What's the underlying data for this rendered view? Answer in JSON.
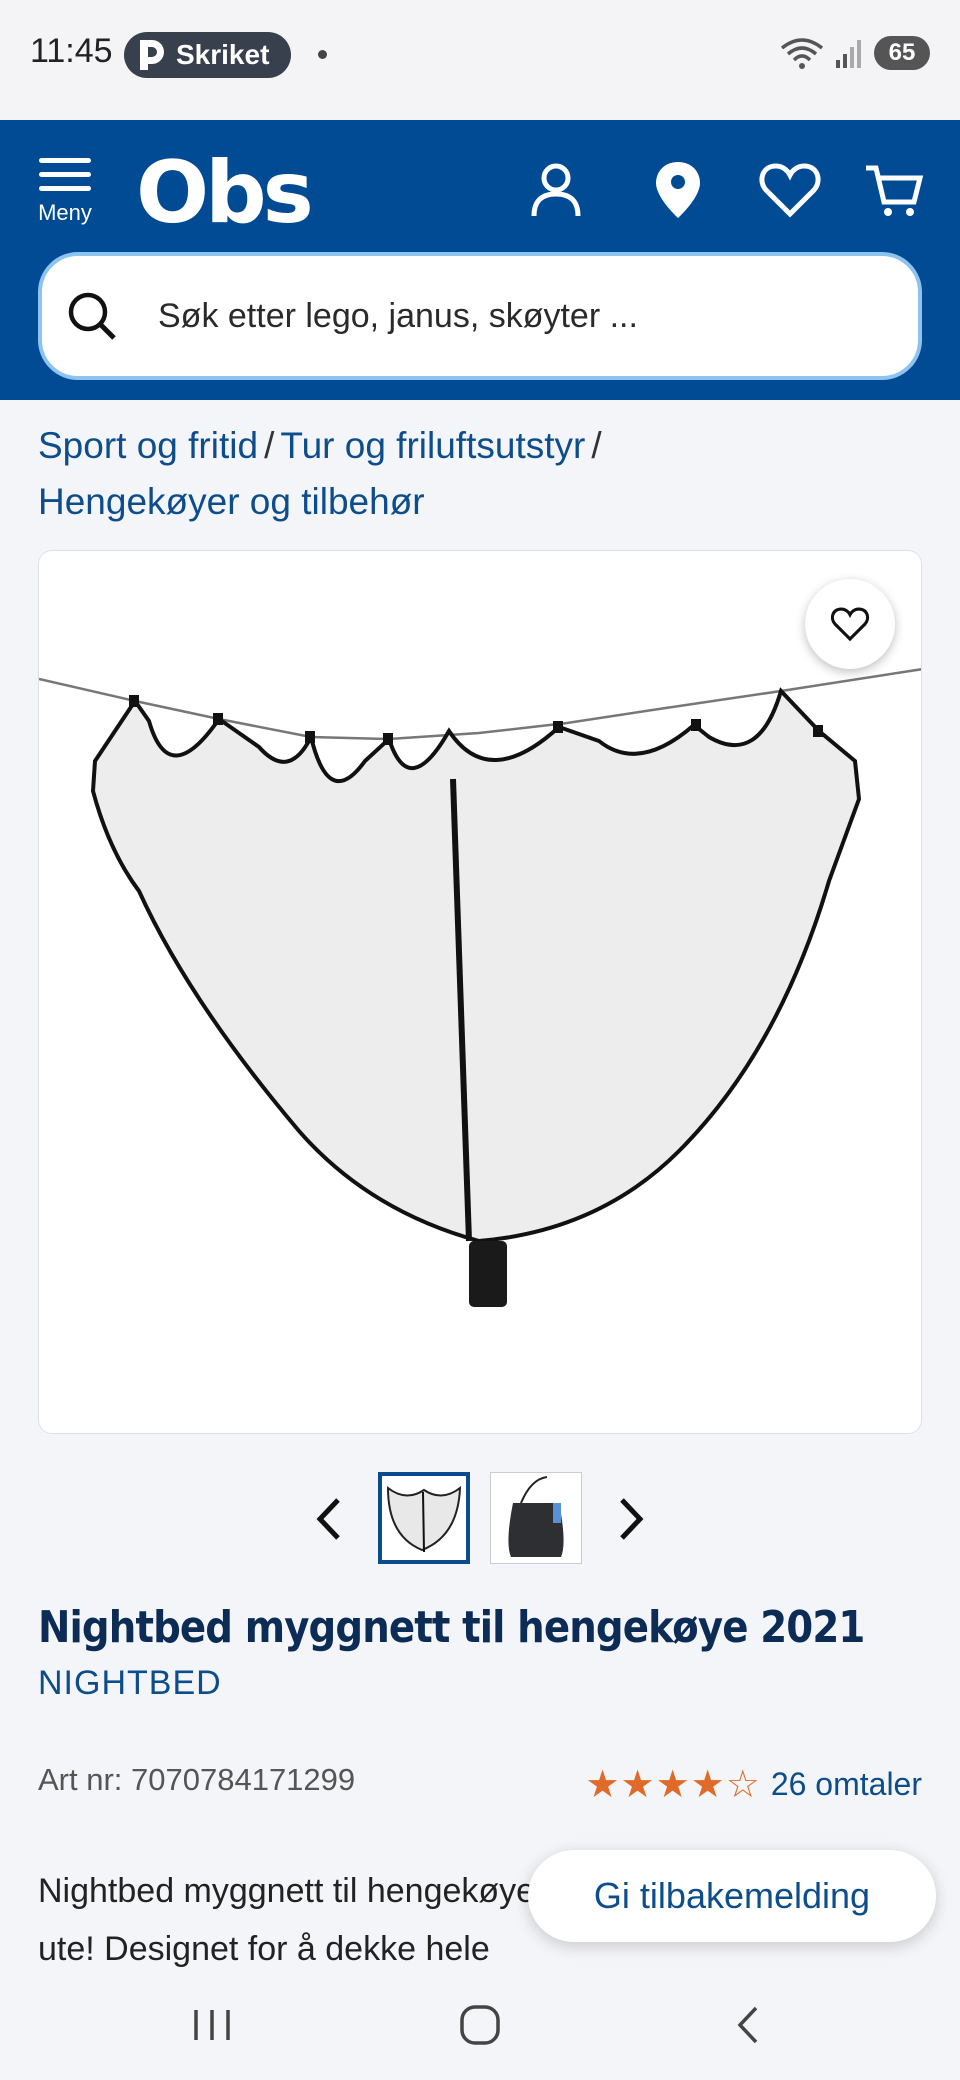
{
  "status_bar": {
    "time": "11:45",
    "app_pill": "Skriket",
    "battery": "65"
  },
  "header": {
    "menu_label": "Meny",
    "logo": "Obs",
    "search_placeholder": "Søk etter lego, janus, skøyter ..."
  },
  "breadcrumb": {
    "items": [
      "Sport og fritid",
      "Tur og friluftsutstyr",
      "Hengekøyer og tilbehør"
    ]
  },
  "product": {
    "title": "Nightbed myggnett til hengekøye 2021",
    "brand": "NIGHTBED",
    "art_nr": "Art nr: 7070784171299",
    "rating_stars": "★★★★☆",
    "rating_value": 4,
    "reviews": "26 omtaler",
    "description": "Nightbed myggnett til hengekøye – hold mygg og knott ute! Designet for å dekke hele"
  },
  "feedback_button": "Gi tilbakemelding",
  "colors": {
    "brand_blue": "#004b93",
    "link_blue": "#0d4d8b",
    "star_orange": "#e06a2a"
  }
}
